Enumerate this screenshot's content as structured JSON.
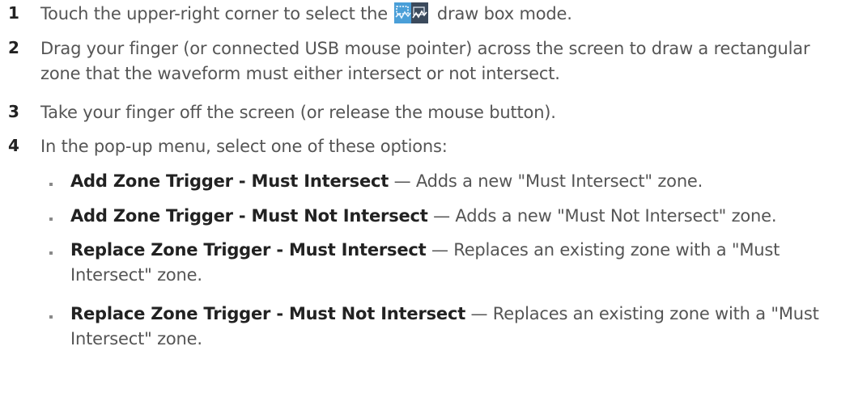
{
  "steps": [
    {
      "number": "1",
      "text_before_icon": "Touch the upper-right corner to select the",
      "icon": "draw-box-mode-icon",
      "text_after_icon": "draw box mode."
    },
    {
      "number": "2",
      "text": "Drag your finger (or connected USB mouse pointer) across the screen to draw a rectangular zone that the waveform must either intersect or not intersect."
    },
    {
      "number": "3",
      "text": "Take your finger off the screen (or release the mouse button)."
    },
    {
      "number": "4",
      "text": "In the pop-up menu, select one of these options:"
    }
  ],
  "options": [
    {
      "title": "Add Zone Trigger - Must Intersect",
      "description": "— Adds a new \"Must Intersect\" zone."
    },
    {
      "title": "Add Zone Trigger - Must Not Intersect",
      "description": "— Adds a new \"Must Not Intersect\" zone."
    },
    {
      "title": "Replace Zone Trigger - Must Intersect",
      "description": "— Replaces an existing zone with a \"Must Intersect\" zone."
    },
    {
      "title": "Replace Zone Trigger - Must Not Intersect",
      "description": "— Replaces an existing zone with a \"Must Intersect\" zone."
    }
  ]
}
